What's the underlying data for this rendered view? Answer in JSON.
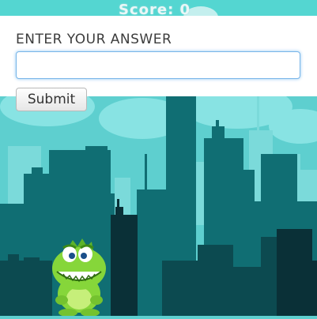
{
  "score": {
    "label": "Score: 0"
  },
  "form": {
    "prompt": "ENTER YOUR ANSWER",
    "answer_value": "",
    "submit_label": "Submit"
  },
  "colors": {
    "sky": "#5ecfcf",
    "city_back": "#79dede",
    "city_mid": "#0f6f74",
    "city_front": "#0d4f55",
    "city_dark": "#0a3036",
    "croc": "#86d63a"
  },
  "character": {
    "name": "crocodile"
  }
}
